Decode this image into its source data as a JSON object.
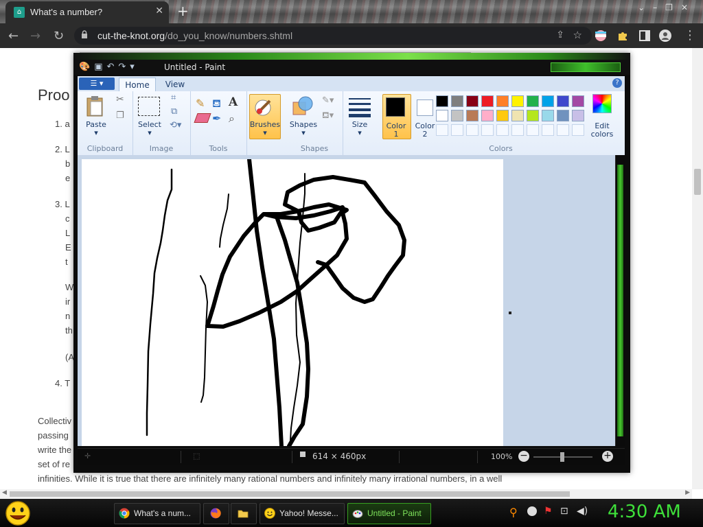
{
  "browser": {
    "tab_title": "What's a number?",
    "url_domain": "cut-the-knot.org",
    "url_path": "/do_you_know/numbers.shtml"
  },
  "webpage": {
    "heading": "Proo",
    "list_items": [
      "1. a",
      "2. L",
      "3. L",
      "4. T"
    ],
    "list_fragments": [
      "b",
      "e",
      "c",
      "L",
      "E",
      "t",
      "W",
      "ir",
      "n",
      "th",
      "(A"
    ],
    "para_lines": [
      "Collectiv",
      "passing",
      "write the",
      "set of re"
    ],
    "bottom_line": "infinities. While it is true that there are infinitely many rational numbers and infinitely many irrational numbers, in a well"
  },
  "paint": {
    "window_title": "Untitled - Paint",
    "tabs": [
      "Home",
      "View"
    ],
    "groups": {
      "clipboard": {
        "label": "Clipboard",
        "paste": "Paste"
      },
      "image": {
        "label": "Image",
        "select": "Select"
      },
      "tools": {
        "label": "Tools"
      },
      "brushes": {
        "label": "Brushes"
      },
      "shapes": {
        "label": "Shapes",
        "shapes_btn": "Shapes"
      },
      "size": {
        "label": "Size"
      },
      "colors": {
        "label": "Colors",
        "color1": "Color",
        "color1_num": "1",
        "color2": "Color",
        "color2_num": "2",
        "edit_colors_1": "Edit",
        "edit_colors_2": "colors",
        "color1_value": "#000000",
        "color2_value": "#ffffff",
        "palette_row1": [
          "#000000",
          "#7f7f7f",
          "#880015",
          "#ed1c24",
          "#ff7f27",
          "#fff200",
          "#22b14c",
          "#00a2e8",
          "#3f48cc",
          "#a349a4"
        ],
        "palette_row2": [
          "#ffffff",
          "#c3c3c3",
          "#b97a57",
          "#ffaec9",
          "#ffc90e",
          "#efe4b0",
          "#b5e61d",
          "#99d9ea",
          "#7092be",
          "#c8bfe7"
        ]
      }
    },
    "status": {
      "dimensions": "614 × 460px",
      "zoom": "100%"
    }
  },
  "taskbar": {
    "items": [
      "What's a num...",
      "",
      "",
      "Yahoo! Messe...",
      "Untitled - Paint"
    ],
    "clock": "4:30 AM"
  }
}
